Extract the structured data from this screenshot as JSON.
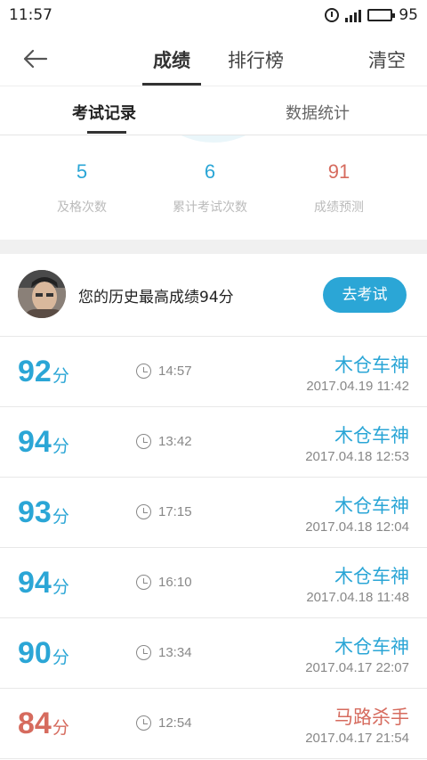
{
  "status_bar": {
    "time": "11:57",
    "battery_percent": "95",
    "battery_level": 0.95,
    "icons": [
      "alarm-icon",
      "signal-icon",
      "battery-icon"
    ]
  },
  "nav": {
    "back_icon": "back-arrow-icon",
    "tabs": [
      {
        "label": "成绩",
        "active": true
      },
      {
        "label": "排行榜",
        "active": false
      }
    ],
    "clear_label": "清空"
  },
  "sub_tabs": [
    {
      "label": "考试记录",
      "active": true
    },
    {
      "label": "数据统计",
      "active": false
    }
  ],
  "stats": [
    {
      "value": "5",
      "label": "及格次数",
      "color": "#2ba6d6"
    },
    {
      "value": "6",
      "label": "累计考试次数",
      "color": "#2ba6d6"
    },
    {
      "value": "91",
      "label": "成绩预测",
      "color": "#d66b5e"
    }
  ],
  "profile": {
    "best_text": "您的历史最高成绩94分",
    "go_label": "去考试"
  },
  "records": [
    {
      "score": "92",
      "unit": "分",
      "duration": "14:57",
      "title": "木仓车神",
      "datetime": "2017.04.19  11:42",
      "pass": true
    },
    {
      "score": "94",
      "unit": "分",
      "duration": "13:42",
      "title": "木仓车神",
      "datetime": "2017.04.18  12:53",
      "pass": true
    },
    {
      "score": "93",
      "unit": "分",
      "duration": "17:15",
      "title": "木仓车神",
      "datetime": "2017.04.18  12:04",
      "pass": true
    },
    {
      "score": "94",
      "unit": "分",
      "duration": "16:10",
      "title": "木仓车神",
      "datetime": "2017.04.18  11:48",
      "pass": true
    },
    {
      "score": "90",
      "unit": "分",
      "duration": "13:34",
      "title": "木仓车神",
      "datetime": "2017.04.17  22:07",
      "pass": true
    },
    {
      "score": "84",
      "unit": "分",
      "duration": "12:54",
      "title": "马路杀手",
      "datetime": "2017.04.17  21:54",
      "pass": false
    }
  ],
  "colors": {
    "accent_blue": "#2ba6d6",
    "fail_red": "#d66b5e"
  }
}
